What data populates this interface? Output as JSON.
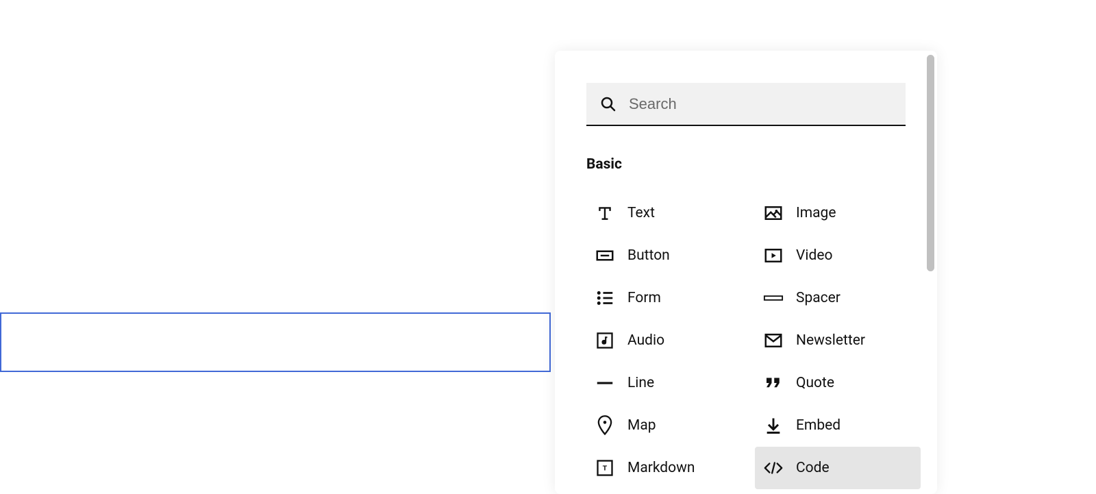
{
  "search": {
    "placeholder": "Search"
  },
  "section": {
    "title": "Basic"
  },
  "items": {
    "text": "Text",
    "image": "Image",
    "button": "Button",
    "video": "Video",
    "form": "Form",
    "spacer": "Spacer",
    "audio": "Audio",
    "newsletter": "Newsletter",
    "line": "Line",
    "quote": "Quote",
    "map": "Map",
    "embed": "Embed",
    "markdown": "Markdown",
    "code": "Code"
  }
}
